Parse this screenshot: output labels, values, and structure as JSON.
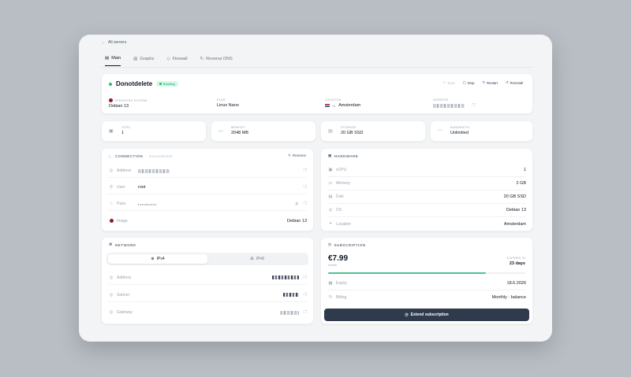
{
  "nav": {
    "back_label": "All servers"
  },
  "tabs": [
    {
      "label": "Main",
      "icon": "server-icon"
    },
    {
      "label": "Graphs",
      "icon": "chart-icon"
    },
    {
      "label": "Firewall",
      "icon": "shield-icon"
    },
    {
      "label": "Reverse DNS",
      "icon": "refresh-icon"
    }
  ],
  "server": {
    "name": "Donotdelete",
    "status": "Running",
    "actions": {
      "start": "Start",
      "stop": "Stop",
      "restart": "Restart",
      "reinstall": "Reinstall"
    },
    "info": {
      "os_label": "OPERATING SYSTEM",
      "os_value": "Debian 13",
      "plan_label": "PLAN",
      "plan_value": "Linux Nano",
      "location_label": "LOCATION",
      "location_value": "Amsterdam",
      "address_label": "ADDRESS"
    }
  },
  "stats": [
    {
      "label": "VCPU",
      "value": "1",
      "icon": "cpu-icon"
    },
    {
      "label": "MEMORY",
      "value": "2048 MB",
      "icon": "memory-icon"
    },
    {
      "label": "STORAGE",
      "value": "20 GB SSD",
      "icon": "storage-icon"
    },
    {
      "label": "BANDWIDTH",
      "value": "Unlimited",
      "icon": "wifi-icon"
    }
  ],
  "connection": {
    "title": "CONNECTION",
    "subtitle": "Donotdelete",
    "rename": "Rename",
    "rows": {
      "address": "Address",
      "user": "User",
      "user_value": "root",
      "pass": "Pass",
      "pass_value": "••••••••••",
      "image": "Image",
      "image_value": "Debian 13"
    }
  },
  "hardware": {
    "title": "HARDWARE",
    "rows": [
      {
        "label": "vCPU",
        "value": "1",
        "icon": "cpu-icon"
      },
      {
        "label": "Memory",
        "value": "2 GB",
        "icon": "memory-icon"
      },
      {
        "label": "Disk",
        "value": "20 GB SSD",
        "icon": "disk-icon"
      },
      {
        "label": "OS",
        "value": "Debian 13",
        "icon": "os-icon"
      },
      {
        "label": "Location",
        "value": "Amsterdam",
        "icon": "pin-icon"
      }
    ]
  },
  "network": {
    "title": "NETWORK",
    "toggle": {
      "ipv4": "IPv4",
      "ipv6": "IPv6"
    },
    "rows": {
      "address": "Address",
      "subnet": "Subnet",
      "gateway": "Gateway"
    }
  },
  "subscription": {
    "title": "SUBSCRIPTION",
    "price": "€7.99",
    "period": "/month",
    "expires_label": "EXPIRES IN",
    "expires_value": "23 days",
    "progress": 0.8,
    "expiry_label": "Expiry",
    "expiry_value": "18.6.2026",
    "billing_label": "Billing",
    "billing_value": "Monthly · balance",
    "extend_button": "Extend subscription"
  },
  "colors": {
    "accent": "#22c55e",
    "progress": "#4fbf8f",
    "button": "#2f3b4c",
    "restart": "#2563eb",
    "reinstall": "#dc2626"
  }
}
